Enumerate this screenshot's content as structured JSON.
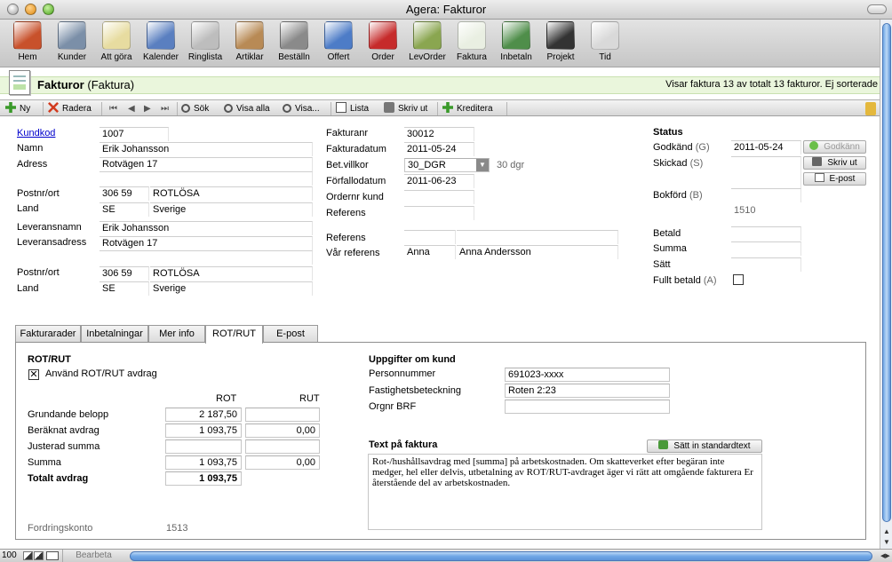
{
  "window": {
    "title": "Agera: Fakturor"
  },
  "toolbar": {
    "items": [
      {
        "label": "Hem",
        "icon": "house-icon",
        "color": "#c8512b"
      },
      {
        "label": "Kunder",
        "icon": "people-icon",
        "color": "#7b8fa8"
      },
      {
        "label": "Att göra",
        "icon": "notepad-pencil-icon",
        "color": "#e7dca0"
      },
      {
        "label": "Kalender",
        "icon": "calendar-icon",
        "color": "#5a7fc0"
      },
      {
        "label": "Ringlista",
        "icon": "telephone-icon",
        "color": "#bdbdbd"
      },
      {
        "label": "Artiklar",
        "icon": "box-icon",
        "color": "#b88a55"
      },
      {
        "label": "Beställn",
        "icon": "fax-machine-icon",
        "color": "#8a8a8a"
      },
      {
        "label": "Offert",
        "icon": "document-blue-icon",
        "color": "#4d7cc7"
      },
      {
        "label": "Order",
        "icon": "book-red-icon",
        "color": "#c62b2b"
      },
      {
        "label": "LevOrder",
        "icon": "inbox-icon",
        "color": "#8aa650"
      },
      {
        "label": "Faktura",
        "icon": "invoice-icon",
        "color": "#e9efe2"
      },
      {
        "label": "Inbetaln",
        "icon": "money-icon",
        "color": "#4f8e4a"
      },
      {
        "label": "Projekt",
        "icon": "briefcase-icon",
        "color": "#333333"
      },
      {
        "label": "Tid",
        "icon": "stopwatch-icon",
        "color": "#d9d9d9"
      }
    ]
  },
  "header": {
    "title": "Fakturor",
    "subtitle": "(Faktura)",
    "info": "Visar faktura 13 av totalt 13 fakturor. Ej sorterade"
  },
  "actions": {
    "new": "Ny",
    "delete": "Radera",
    "search": "Sök",
    "show_all": "Visa alla",
    "show": "Visa...",
    "list": "Lista",
    "print": "Skriv ut",
    "credit": "Kreditera"
  },
  "customer": {
    "kundkod_label": "Kundkod",
    "kundkod": "1007",
    "namn_label": "Namn",
    "namn": "Erik Johansson",
    "adress_label": "Adress",
    "adress": "Rotvägen 17",
    "adress2": "",
    "postnr_label": "Postnr/ort",
    "postnr": "306 59",
    "ort": "ROTLÖSA",
    "land_label": "Land",
    "landkod": "SE",
    "land": "Sverige",
    "levnamn_label": "Leveransnamn",
    "levnamn": "Erik Johansson",
    "levadress_label": "Leveransadress",
    "levadress": "Rotvägen 17",
    "levadress2": "",
    "levpostnr_label": "Postnr/ort",
    "levpostnr": "306 59",
    "levort": "ROTLÖSA",
    "levland_label": "Land",
    "levlandkod": "SE",
    "levland": "Sverige"
  },
  "invoice": {
    "fakturanr_label": "Fakturanr",
    "fakturanr": "30012",
    "fakturadatum_label": "Fakturadatum",
    "fakturadatum": "2011-05-24",
    "betvillkor_label": "Bet.villkor",
    "betvillkor": "30_DGR",
    "betvillkor_hint": "30 dgr",
    "forfallo_label": "Förfallodatum",
    "forfallo": "2011-06-23",
    "ordernr_label": "Ordernr kund",
    "ordernr": "",
    "referens_label": "Referens",
    "referens": "",
    "referens2_label": "Referens",
    "referens2_a": "",
    "referens2_b": "",
    "varref_label": "Vår referens",
    "varref_code": "Anna",
    "varref_name": "Anna Andersson"
  },
  "status": {
    "title": "Status",
    "godkand_label": "Godkänd",
    "godkand_key": "(G)",
    "godkand": "2011-05-24",
    "skickad_label": "Skickad",
    "skickad_key": "(S)",
    "skickad": "",
    "bokford_label": "Bokförd",
    "bokford_key": "(B)",
    "bokford": "",
    "bokford_konto": "1510",
    "betald_label": "Betald",
    "betald": "",
    "summa_label": "Summa",
    "summa": "",
    "satt_label": "Sätt",
    "satt": "",
    "fullt_label": "Fullt betald",
    "fullt_key": "(A)",
    "fullt_checked": false,
    "approve_btn": "Godkänn",
    "print_btn": "Skriv ut",
    "email_btn": "E-post"
  },
  "tabs": [
    {
      "label": "Fakturarader",
      "active": false
    },
    {
      "label": "Inbetalningar",
      "active": false
    },
    {
      "label": "Mer info",
      "active": false
    },
    {
      "label": "ROT/RUT",
      "active": true
    },
    {
      "label": "E-post",
      "active": false
    }
  ],
  "rot": {
    "heading": "ROT/RUT",
    "use_label": "Använd ROT/RUT avdrag",
    "use_checked": true,
    "col_rot": "ROT",
    "col_rut": "RUT",
    "rows": [
      {
        "label": "Grundande belopp",
        "rot": "2 187,50",
        "rut": "",
        "bold": false
      },
      {
        "label": "Beräknat avdrag",
        "rot": "1 093,75",
        "rut": "0,00",
        "bold": false
      },
      {
        "label": "Justerad summa",
        "rot": "",
        "rut": "",
        "bold": false
      },
      {
        "label": "Summa",
        "rot": "1 093,75",
        "rut": "0,00",
        "bold": false
      },
      {
        "label": "Totalt avdrag",
        "rot": "1 093,75",
        "rut": "",
        "bold": true
      }
    ],
    "fordring_label": "Fordringskonto",
    "fordring": "1513"
  },
  "kund": {
    "heading": "Uppgifter om kund",
    "personnr_label": "Personnummer",
    "personnr": "691023-xxxx",
    "fastighet_label": "Fastighetsbeteckning",
    "fastighet": "Roten 2:23",
    "orgnr_label": "Orgnr BRF",
    "orgnr": ""
  },
  "textfaktura": {
    "heading": "Text på faktura",
    "standard_btn": "Sätt in standardtext",
    "text": "Rot-/hushållsavdrag med [summa] på arbetskostnaden. Om skatteverket efter begäran inte medger, hel eller delvis, utbetalning av ROT/RUT-avdraget äger vi rätt att omgående fakturera Er återstående del av arbetskostnaden."
  },
  "bottom": {
    "zoom": "100",
    "mode": "Bearbeta"
  }
}
